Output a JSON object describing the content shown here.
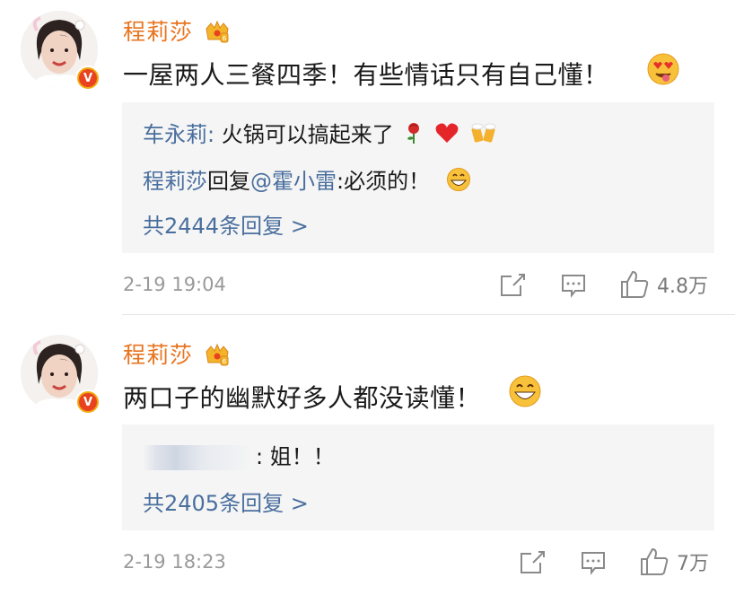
{
  "comments": [
    {
      "username": "程莉莎",
      "text": "一屋两人三餐四季！有些情话只有自己懂！",
      "text_emoji": "heart-eyes-tongue-emoji",
      "replies": [
        {
          "author": "车永莉",
          "sep": ": ",
          "text": "火锅可以搞起来了"
        },
        {
          "author": "程莉莎",
          "mid": "回复",
          "mention": "@霍小雷",
          "text": ":必须的！"
        }
      ],
      "more_label": "共2444条回复 >",
      "time": "2-19 19:04",
      "likes": "4.8万"
    },
    {
      "username": "程莉莎",
      "text": "两口子的幽默好多人都没读懂！",
      "text_emoji": "grin-emoji",
      "replies": [
        {
          "author_blurred": true,
          "text": ": 姐！！"
        }
      ],
      "more_label": "共2405条回复 >",
      "time": "2-19 18:23",
      "likes": "7万"
    }
  ],
  "colors": {
    "username": "#e8741f",
    "link": "#4a6f9e",
    "meta": "#9a9a9a",
    "reply_bg": "#f5f5f5",
    "badge": "#f0aa12"
  }
}
